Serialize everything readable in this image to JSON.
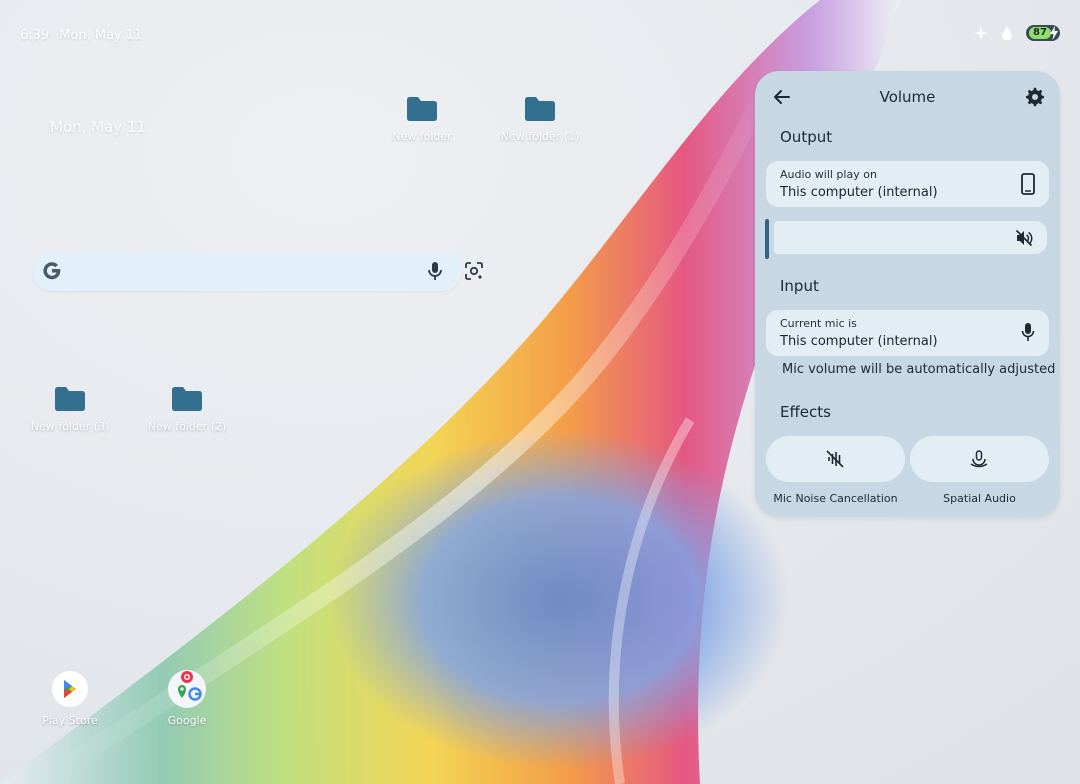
{
  "status_bar": {
    "time": "6:39",
    "date": "Mon, May 11",
    "battery_level": "87"
  },
  "home": {
    "date_widget": "Mon, May 11"
  },
  "desktop_folders": [
    {
      "label": "New folder"
    },
    {
      "label": "New folder (1)"
    },
    {
      "label": "New folder (3)"
    },
    {
      "label": "New folder (2)"
    }
  ],
  "dock_apps": [
    {
      "label": "Play Store"
    },
    {
      "label": "Google"
    }
  ],
  "volume_panel": {
    "title": "Volume",
    "output": {
      "section_title": "Output",
      "sublabel": "Audio will play on",
      "device": "This computer (internal)",
      "volume_level": 0
    },
    "input": {
      "section_title": "Input",
      "sublabel": "Current mic is",
      "device": "This computer (internal)",
      "note": "Mic volume will be automatically adjusted"
    },
    "effects": {
      "section_title": "Effects",
      "items": [
        {
          "label": "Mic Noise Cancellation"
        },
        {
          "label": "Spatial Audio"
        }
      ]
    }
  },
  "colors": {
    "panel_background": "#c7d7e3",
    "card_background": "#e3edf4",
    "folder_icon": "#336f8e",
    "slider_handle": "#35637f"
  }
}
